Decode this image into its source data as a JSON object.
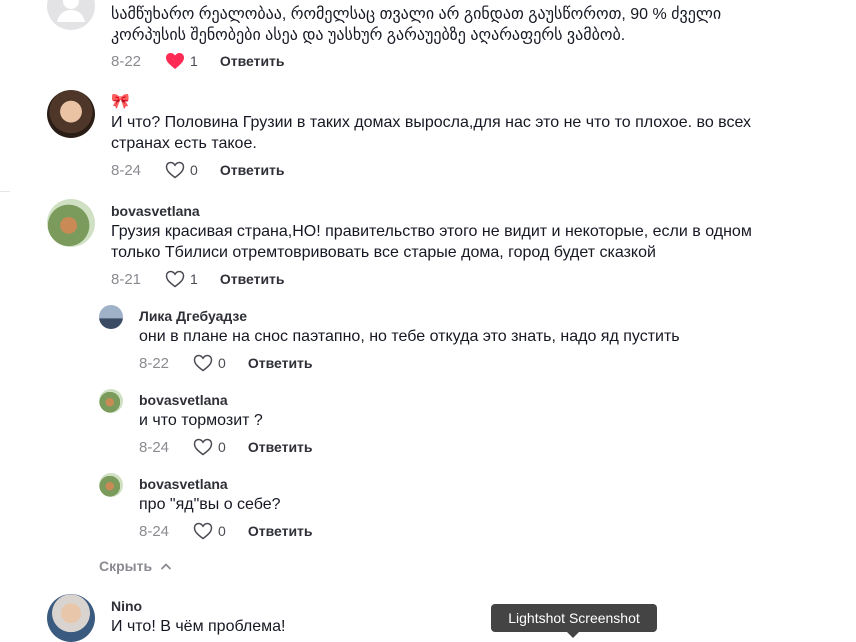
{
  "comments": [
    {
      "text": "სამწუხარო რეალობაა, რომელსაც თვალი არ გინდათ გაუსწოროთ, 90 % ძველი კორპუსის შენობები ასეა და უასხურ გარაუებზე აღარაფერს ვამბობ.",
      "date": "8-22",
      "likes": "1",
      "reply": "Ответить"
    },
    {
      "name": "🎀",
      "text": "И что? Половина Грузии в таких домах выросла,для нас это не что то плохое. во всех странах есть такое.",
      "date": "8-24",
      "likes": "0",
      "reply": "Ответить"
    },
    {
      "name": "bovasvetlana",
      "text": "Грузия красивая страна,НО! правительство этого не видит и некоторые, если в одном только Тбилиси отремтовривовать все старые дома, город будет сказкой",
      "date": "8-21",
      "likes": "1",
      "reply": "Ответить"
    },
    {
      "name": "Лика Дгебуадзе",
      "text": "они в плане на снос паэтапно, но тебе откуда это знать, надо яд пустить",
      "date": "8-22",
      "likes": "0",
      "reply": "Ответить"
    },
    {
      "name": "bovasvetlana",
      "text": "и что тормозит ?",
      "date": "8-24",
      "likes": "0",
      "reply": "Ответить"
    },
    {
      "name": "bovasvetlana",
      "text": "про \"яд\"вы о себе?",
      "date": "8-24",
      "likes": "0",
      "reply": "Ответить"
    },
    {
      "name": "Nino",
      "text": "И что! В чём проблема!"
    }
  ],
  "hide_label": "Скрыть",
  "tooltip": "Lightshot Screenshot",
  "colors": {
    "liked_heart": "#fe2c55",
    "muted": "#8a8b91",
    "text": "#161823"
  },
  "icons": {
    "like": "heart-icon",
    "hide": "chevron-up-icon"
  }
}
